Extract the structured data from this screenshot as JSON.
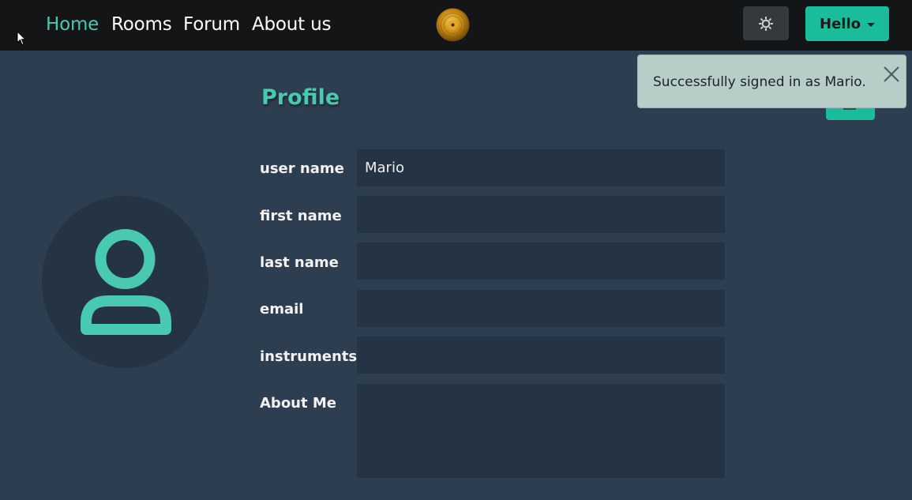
{
  "navbar": {
    "links": [
      {
        "label": "Home",
        "active": true
      },
      {
        "label": "Rooms",
        "active": false
      },
      {
        "label": "Forum",
        "active": false
      },
      {
        "label": "About us",
        "active": false
      }
    ],
    "logo_icon": "vinyl-record-icon",
    "theme_toggle_icon": "sun-icon",
    "user_menu_label": "Hello"
  },
  "toast": {
    "message": "Successfully signed in as Mario.",
    "close_icon": "close-icon"
  },
  "profile": {
    "title": "Profile",
    "edit_icon": "edit-icon",
    "avatar_icon": "user-icon",
    "fields": [
      {
        "label": "user name",
        "value": "Mario"
      },
      {
        "label": "first name",
        "value": ""
      },
      {
        "label": "last name",
        "value": ""
      },
      {
        "label": "email",
        "value": ""
      },
      {
        "label": "instruments",
        "value": ""
      },
      {
        "label": "About Me",
        "value": ""
      }
    ]
  },
  "colors": {
    "accent": "#1abc9c",
    "accent_text": "#48c9b0",
    "background": "#2c3e50",
    "navbar": "#141517",
    "input_bg": "#253444"
  }
}
